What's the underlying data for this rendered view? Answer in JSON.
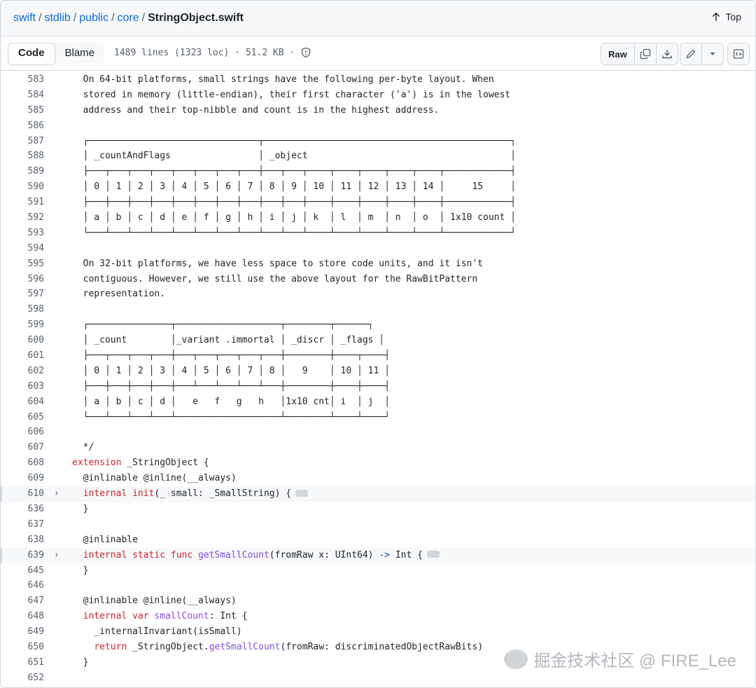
{
  "breadcrumb": {
    "parts": [
      "swift",
      "stdlib",
      "public",
      "core"
    ],
    "file": "StringObject.swift",
    "separator": "/"
  },
  "top_link": "Top",
  "toolbar": {
    "tab_code": "Code",
    "tab_blame": "Blame",
    "file_info": "1489 lines (1323 loc) · 51.2 KB ·",
    "raw_label": "Raw"
  },
  "icons": {
    "top": "arrow-up-icon",
    "info": "shield-icon",
    "copy": "copy-icon",
    "download": "download-icon",
    "edit": "pencil-icon",
    "more": "caret-down-icon",
    "symbols": "code-square-icon",
    "expand": "chevron-right-icon"
  },
  "code_lines": [
    {
      "n": "583",
      "t": "  On 64-bit platforms, small strings have the following per-byte layout. When"
    },
    {
      "n": "584",
      "t": "  stored in memory (little-endian), their first character ('a') is in the lowest"
    },
    {
      "n": "585",
      "t": "  address and their top-nibble and count is in the highest address."
    },
    {
      "n": "586",
      "t": ""
    },
    {
      "n": "587",
      "t": "  ┌───────────────────────────────┬─────────────────────────────────────────────┐"
    },
    {
      "n": "588",
      "t": "  │ _countAndFlags                │ _object                                     │"
    },
    {
      "n": "589",
      "t": "  ├───┬───┬───┬───┬───┬───┬───┬───┼───┬───┬────┬────┬────┬────┬────┬────────────┤"
    },
    {
      "n": "590",
      "t": "  │ 0 │ 1 │ 2 │ 3 │ 4 │ 5 │ 6 │ 7 │ 8 │ 9 │ 10 │ 11 │ 12 │ 13 │ 14 │     15     │"
    },
    {
      "n": "591",
      "t": "  ├───┼───┼───┼───┼───┼───┼───┼───┼───┼───┼────┼────┼────┼────┼────┼────────────┤"
    },
    {
      "n": "592",
      "t": "  │ a │ b │ c │ d │ e │ f │ g │ h │ i │ j │ k  │ l  │ m  │ n  │ o  │ 1x10 count │"
    },
    {
      "n": "593",
      "t": "  └───┴───┴───┴───┴───┴───┴───┴───┴───┴───┴────┴────┴────┴────┴────┴────────────┘"
    },
    {
      "n": "594",
      "t": ""
    },
    {
      "n": "595",
      "t": "  On 32-bit platforms, we have less space to store code units, and it isn't"
    },
    {
      "n": "596",
      "t": "  contiguous. However, we still use the above layout for the RawBitPattern"
    },
    {
      "n": "597",
      "t": "  representation."
    },
    {
      "n": "598",
      "t": ""
    },
    {
      "n": "599",
      "t": "  ┌───────────────┬───────────────────┬────────┬──────┐"
    },
    {
      "n": "600",
      "t": "  │ _count        │_variant .immortal │ _discr │ _flags │"
    },
    {
      "n": "601",
      "t": "  ├───┬───┬───┬───┼───┬───┬───┬───┬───┼────────┼────┬────┤"
    },
    {
      "n": "602",
      "t": "  │ 0 │ 1 │ 2 │ 3 │ 4 │ 5 │ 6 │ 7 │ 8 │   9    │ 10 │ 11 │"
    },
    {
      "n": "603",
      "t": "  ├───┼───┼───┼───┼───┴───┴───┴───┴───┼────────┼────┼────┤"
    },
    {
      "n": "604",
      "t": "  │ a │ b │ c │ d │   e   f   g   h   │1x10 cnt│ i  │ j  │"
    },
    {
      "n": "605",
      "t": "  └───┴───┴───┴───┴───────────────────┴────────┴────┴────┘"
    },
    {
      "n": "606",
      "t": ""
    },
    {
      "n": "607",
      "t": "  */"
    },
    {
      "n": "608",
      "t": "extension _StringObject {"
    },
    {
      "n": "609",
      "t": "  @inlinable @inline(__always)"
    },
    {
      "n": "610",
      "t": "  internal init(_ small: _SmallString) {"
    },
    {
      "n": "636",
      "t": "  }"
    },
    {
      "n": "637",
      "t": ""
    },
    {
      "n": "638",
      "t": "  @inlinable"
    },
    {
      "n": "639",
      "t": "  internal static func getSmallCount(fromRaw x: UInt64) -> Int {"
    },
    {
      "n": "645",
      "t": "  }"
    },
    {
      "n": "646",
      "t": ""
    },
    {
      "n": "647",
      "t": "  @inlinable @inline(__always)"
    },
    {
      "n": "648",
      "t": "  internal var smallCount: Int {"
    },
    {
      "n": "649",
      "t": "    _internalInvariant(isSmall)"
    },
    {
      "n": "650",
      "t": "    return _StringObject.getSmallCount(fromRaw: discriminatedObjectRawBits)"
    },
    {
      "n": "651",
      "t": "  }"
    },
    {
      "n": "652",
      "t": ""
    }
  ],
  "folded_lines": [
    "610",
    "639"
  ],
  "watermark": "掘金技术社区 @ FIRE_Lee"
}
